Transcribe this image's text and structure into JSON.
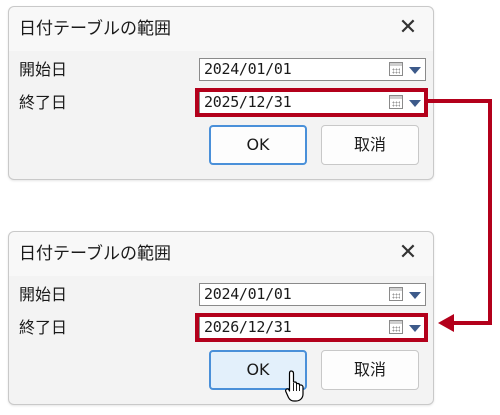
{
  "dialogs": [
    {
      "title": "日付テーブルの範囲",
      "close_label": "✕",
      "start_label": "開始日",
      "start_value": "2024/01/01",
      "end_label": "終了日",
      "end_value": "2025/12/31",
      "ok_label": "OK",
      "cancel_label": "取消"
    },
    {
      "title": "日付テーブルの範囲",
      "close_label": "✕",
      "start_label": "開始日",
      "start_value": "2024/01/01",
      "end_label": "終了日",
      "end_value": "2026/12/31",
      "ok_label": "OK",
      "cancel_label": "取消"
    }
  ],
  "annotation": {
    "highlight_color": "#b3001b",
    "arrow_color": "#b3001b"
  },
  "icons": {
    "calendar": "calendar-icon",
    "dropdown": "dropdown-arrow-icon",
    "close": "close-icon",
    "cursor": "hand-pointer-cursor-icon"
  }
}
